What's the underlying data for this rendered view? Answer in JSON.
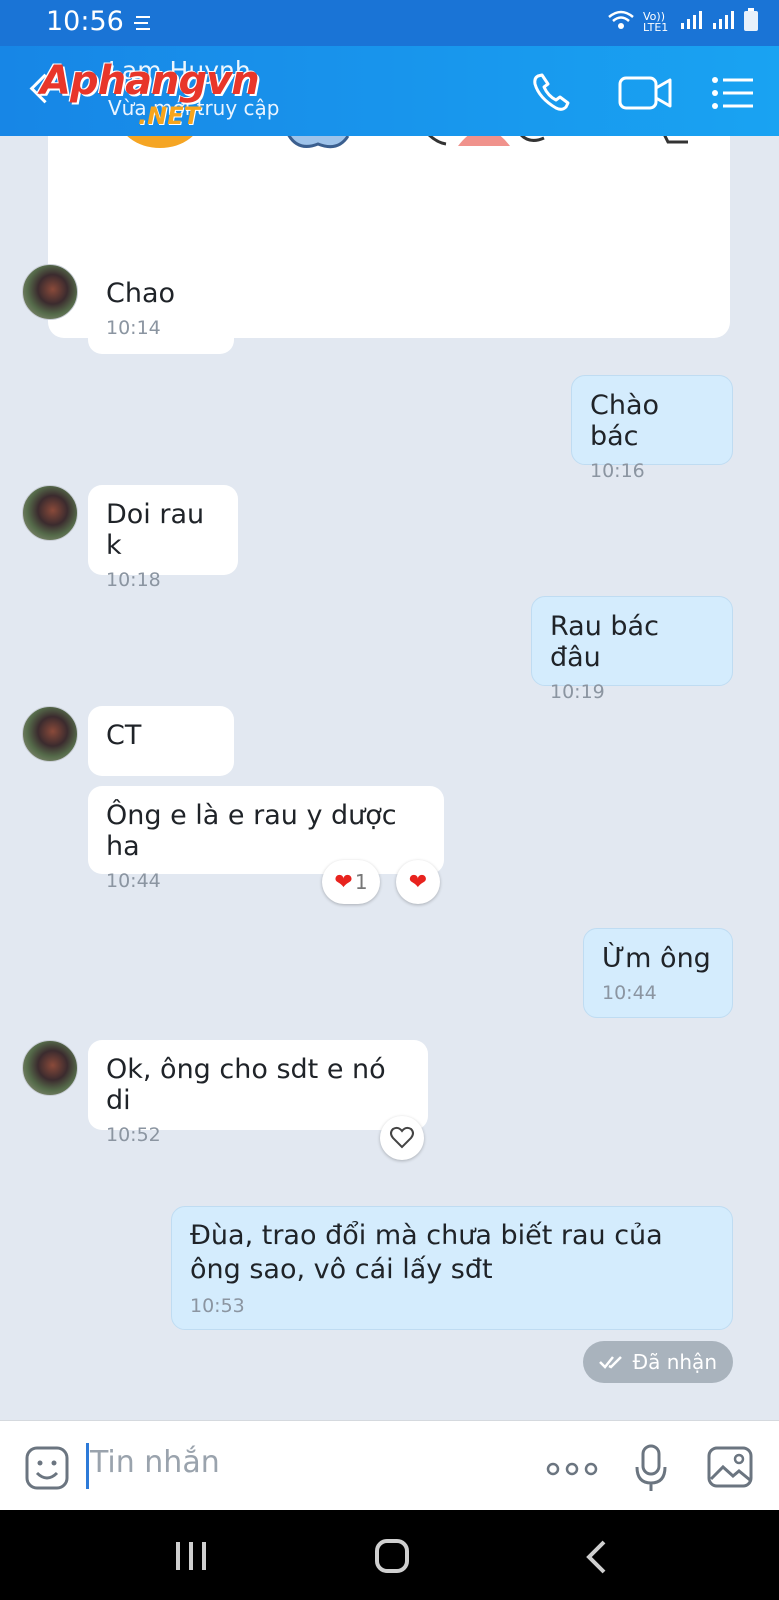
{
  "status_bar": {
    "time": "10:56",
    "network_label": "Vo)) LTE1"
  },
  "header": {
    "contact_name": "Lam Huynh",
    "status": "Vừa mới truy cập",
    "watermark_top": "Aphangvn",
    "watermark_bottom": ".NET",
    "icons": [
      "back-icon",
      "phone-icon",
      "video-call-icon",
      "menu-icon"
    ]
  },
  "messages": [
    {
      "dir": "in",
      "text": "Chao",
      "time": "10:14"
    },
    {
      "dir": "out",
      "text": "Chào bác",
      "time": "10:16"
    },
    {
      "dir": "in",
      "text": "Doi rau k",
      "time": "10:18"
    },
    {
      "dir": "out",
      "text": "Rau bác đâu",
      "time": "10:19"
    },
    {
      "dir": "in",
      "text": "CT",
      "time": ""
    },
    {
      "dir": "in",
      "text": "Ông e là e rau y dược ha",
      "time": "10:44",
      "reaction_count": "1"
    },
    {
      "dir": "out",
      "text": "Ừm ông",
      "time": "10:44"
    },
    {
      "dir": "in",
      "text": "Ok, ông cho sdt e nó di",
      "time": "10:52"
    },
    {
      "dir": "out",
      "text": "Đùa, trao đổi mà chưa biết rau của ông sao, vô cái lấy sđt",
      "time": "10:53"
    }
  ],
  "receipt": "Đã nhận",
  "input": {
    "placeholder": "Tin nhắn",
    "icons": [
      "emoji-icon",
      "more-icon",
      "microphone-icon",
      "image-icon"
    ]
  },
  "colors": {
    "header": "#1a8ee8",
    "background": "#e2e8f1",
    "outgoing_bubble": "#d4ecfd",
    "incoming_bubble": "#ffffff"
  }
}
